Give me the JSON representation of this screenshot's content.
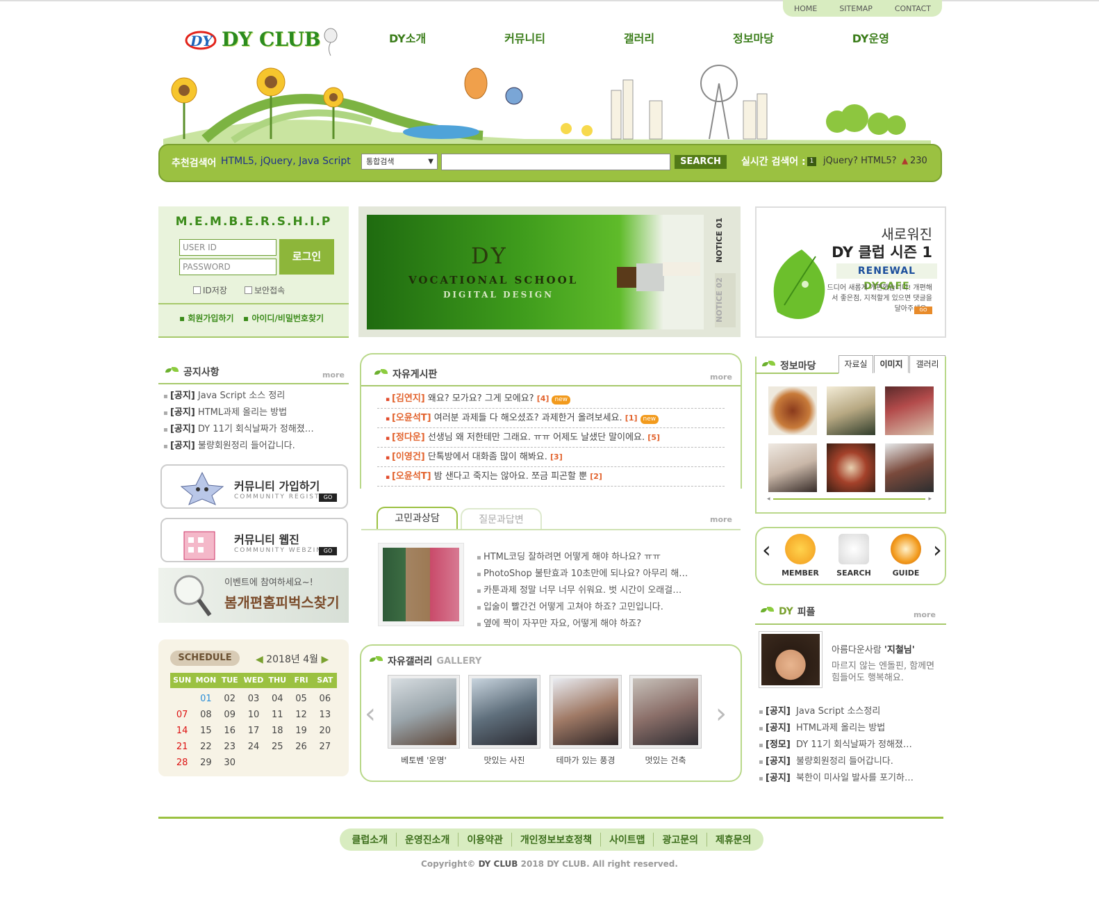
{
  "util_menu": [
    "HOME",
    "SITEMAP",
    "CONTACT"
  ],
  "logo": {
    "mark": "DY",
    "name": "DY CLUB"
  },
  "gnb": [
    "DY소개",
    "커뮤니티",
    "갤러리",
    "정보마당",
    "DY운영"
  ],
  "search": {
    "recommend_label": "추천검색어",
    "recommend_value": "HTML5, jQuery, Java Script",
    "select_value": "통합검색",
    "button": "SEARCH",
    "realtime_label": "실시간 검색어 :",
    "realtime_rank": "1",
    "realtime_value": "jQuery? HTML5?",
    "realtime_count": "230"
  },
  "membership": {
    "title": "M.E.M.B.E.R.S.H.I.P",
    "id_placeholder": "USER ID",
    "pw_placeholder": "PASSWORD",
    "login": "로그인",
    "save_id": "ID저장",
    "secure": "보안접속",
    "join": "회원가입하기",
    "find": "아이디/비밀번호찾기"
  },
  "notice": {
    "title": "공지사항",
    "more": "more",
    "items": [
      {
        "tag": "[공지]",
        "text": "Java Script 소스 정리"
      },
      {
        "tag": "[공지]",
        "text": "HTML과제 올리는 방법"
      },
      {
        "tag": "[공지]",
        "text": "DY 11기 회식날짜가 정해졌…"
      },
      {
        "tag": "[공지]",
        "text": "불량회원정리 들어갑니다."
      }
    ]
  },
  "promos": [
    {
      "title": "커뮤니티 가입하기",
      "sub": "COMMUNITY REGISTE",
      "go": "GO"
    },
    {
      "title": "커뮤니티 웹진",
      "sub": "COMMUNITY WEBZINE",
      "go": "GO"
    }
  ],
  "event": {
    "line1": "이벤트에 참여하세요~!",
    "line2": "봄개편홈피벅스찾기"
  },
  "calendar": {
    "label": "SCHEDULE",
    "month": "2018년 4월",
    "days": [
      "SUN",
      "MON",
      "TUE",
      "WED",
      "THU",
      "FRI",
      "SAT"
    ],
    "weeks": [
      [
        "",
        "01",
        "02",
        "03",
        "04",
        "05",
        "06"
      ],
      [
        "07",
        "08",
        "09",
        "10",
        "11",
        "12",
        "13"
      ],
      [
        "14",
        "15",
        "16",
        "17",
        "18",
        "19",
        "20"
      ],
      [
        "21",
        "22",
        "23",
        "24",
        "25",
        "26",
        "27"
      ],
      [
        "28",
        "29",
        "30",
        "",
        "",
        "",
        ""
      ]
    ],
    "today": "01"
  },
  "visual": {
    "dy": "DY",
    "school": "VOCATIONAL SCHOOL",
    "design": "DIGITAL DESIGN",
    "notice1": "NOTICE 01",
    "notice2": "NOTICE 02"
  },
  "board": {
    "title": "자유게시판",
    "more": "more",
    "items": [
      {
        "author": "[김연지]",
        "text": "왜요? 모가요? 그게 모에요?",
        "count": "[4]",
        "new": "new"
      },
      {
        "author": "[오윤석T]",
        "text": "여러분 과제들 다 해오셨죠? 과제한거 올려보세요.",
        "count": "[1]",
        "new": "new"
      },
      {
        "author": "[정다운]",
        "text": "선생님 왜 저한테만 그래요. ㅠㅠ 어제도 날샜단 말이에요.",
        "count": "[5]",
        "new": ""
      },
      {
        "author": "[이영건]",
        "text": "단톡방에서 대화좀 많이 해봐요.",
        "count": "[3]",
        "new": ""
      },
      {
        "author": "[오윤석T]",
        "text": "밤 샌다고 죽지는 않아요. 쪼금 피곤할 뿐",
        "count": "[2]",
        "new": ""
      }
    ]
  },
  "qna": {
    "tab1": "고민과상담",
    "tab2": "질문과답변",
    "more": "more",
    "items": [
      "HTML코딩 잘하려면 어떻게 해야 하나요? ㅠㅠ",
      "PhotoShop 불탄효과 10초만에 되나요? 아무리 해…",
      "카툰과제 정말 너무 너무 쉬워요. 벗 시간이 오래걸…",
      "입술이 빨간건 어떻게 고쳐야 하죠? 고민입니다.",
      "옆에 짝이 자꾸만 자요, 어떻게 해야 하죠?"
    ]
  },
  "gallery": {
    "title": "자유갤러리",
    "sub": "GALLERY",
    "items": [
      "베토벤 '운명'",
      "맛있는 사진",
      "테마가 있는 풍경",
      "멋있는 건축"
    ]
  },
  "ad": {
    "line1": "새로워진",
    "line2": "DY 클럽 시즌 1",
    "line3a": "RENEWAL",
    "line3b": "DYCAFE",
    "line4": "드디어 새롭게 개편했습니다! 개편해서 좋은점, 지적할게 있으면 댓글을 달아주세요~",
    "go": "GO"
  },
  "info": {
    "title": "정보마당",
    "tabs": [
      "자료실",
      "이미지",
      "갤러리"
    ]
  },
  "quick": [
    {
      "label": "MEMBER"
    },
    {
      "label": "SEARCH"
    },
    {
      "label": "GUIDE"
    }
  ],
  "people": {
    "title_a": "DY",
    "title_b": "피플",
    "more": "more",
    "name_pre": "아름다운사람",
    "name": "'지철님'",
    "desc": "마르지 않는 엔돌핀, 함께면 힘들어도 행복해요.",
    "items": [
      {
        "tag": "[공지]",
        "text": "Java Script 소스정리"
      },
      {
        "tag": "[공지]",
        "text": "HTML과제 올리는 방법"
      },
      {
        "tag": "[정모]",
        "text": "DY 11기 회식날짜가 정해졌…"
      },
      {
        "tag": "[공지]",
        "text": "불량회원정리 들어갑니다."
      },
      {
        "tag": "[공지]",
        "text": "북한이 미사일 발사를 포기하…"
      }
    ]
  },
  "footer": {
    "menu": [
      "클럽소개",
      "운영진소개",
      "이용약관",
      "개인정보보호정책",
      "사이트맵",
      "광고문의",
      "제휴문의"
    ],
    "copy_a": "Copyright© ",
    "copy_b": "DY CLUB",
    "copy_c": " 2018 DY CLUB. All right reserved."
  }
}
